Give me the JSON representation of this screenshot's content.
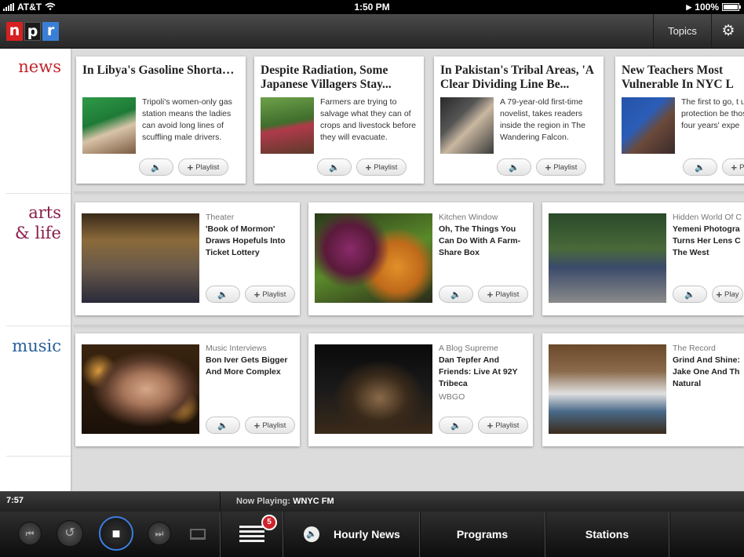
{
  "status_bar": {
    "carrier": "AT&T",
    "time": "1:50 PM",
    "battery": "100%"
  },
  "header": {
    "logo_letters": [
      "n",
      "p",
      "r"
    ],
    "topics_label": "Topics",
    "settings_icon": "gear-icon"
  },
  "categories": {
    "news": "news",
    "arts_line1": "arts",
    "arts_line2": "& life",
    "music": "music"
  },
  "news": [
    {
      "headline": "In Libya's Gasoline Shortage, Women Get A...",
      "teaser": "Tripoli's women-only gas station means the ladies can avoid long lines of scuffling male drivers.",
      "playlist": "Playlist"
    },
    {
      "headline": "Despite Radiation, Some Japanese Villagers Stay...",
      "teaser": "Farmers are trying to salvage what they can of crops and livestock before they will evacuate.",
      "playlist": "Playlist"
    },
    {
      "headline": "In Pakistan's Tribal Areas, 'A Clear Dividing Line Be...",
      "teaser": "A 79-year-old first-time novelist, takes readers inside the region in The Wandering Falcon.",
      "playlist": "Playlist"
    },
    {
      "headline": "New Teachers Most Vulnerable In NYC L",
      "teaser": "The first to go, t union protection be those with le four years' expe",
      "playlist": "P"
    }
  ],
  "arts": [
    {
      "kicker": "Theater",
      "title": "'Book of Mormon' Draws Hopefuls Into Ticket Lottery",
      "playlist": "Playlist"
    },
    {
      "kicker": "Kitchen Window",
      "title": "Oh, The Things You Can Do With A Farm-Share Box",
      "playlist": "Playlist"
    },
    {
      "kicker": "Hidden World Of C",
      "title": "Yemeni Photogra Turns Her Lens C The West",
      "playlist": "Play"
    }
  ],
  "music": [
    {
      "kicker": "Music Interviews",
      "title": "Bon Iver Gets Bigger And More Complex",
      "sub": "",
      "playlist": "Playlist"
    },
    {
      "kicker": "A Blog Supreme",
      "title": "Dan Tepfer And Friends: Live At 92Y Tribeca",
      "sub": "WBGO",
      "playlist": "Playlist"
    },
    {
      "kicker": "The Record",
      "title": "Grind And Shine: Jake One And Th Natural",
      "sub": "",
      "playlist": ""
    }
  ],
  "player": {
    "clock": "7:57",
    "now_playing_label": "Now Playing:",
    "station": "WNYC FM",
    "playlist_count": "5",
    "hourly_news": "Hourly News",
    "programs": "Programs",
    "stations": "Stations"
  },
  "colors": {
    "npr_red": "#d62021",
    "npr_blue": "#3a7fd5",
    "news": "#c0252b",
    "arts": "#8a1d4b",
    "music": "#2a5f9a",
    "stop_ring": "#3b7fe0",
    "badge": "#d0232a"
  }
}
